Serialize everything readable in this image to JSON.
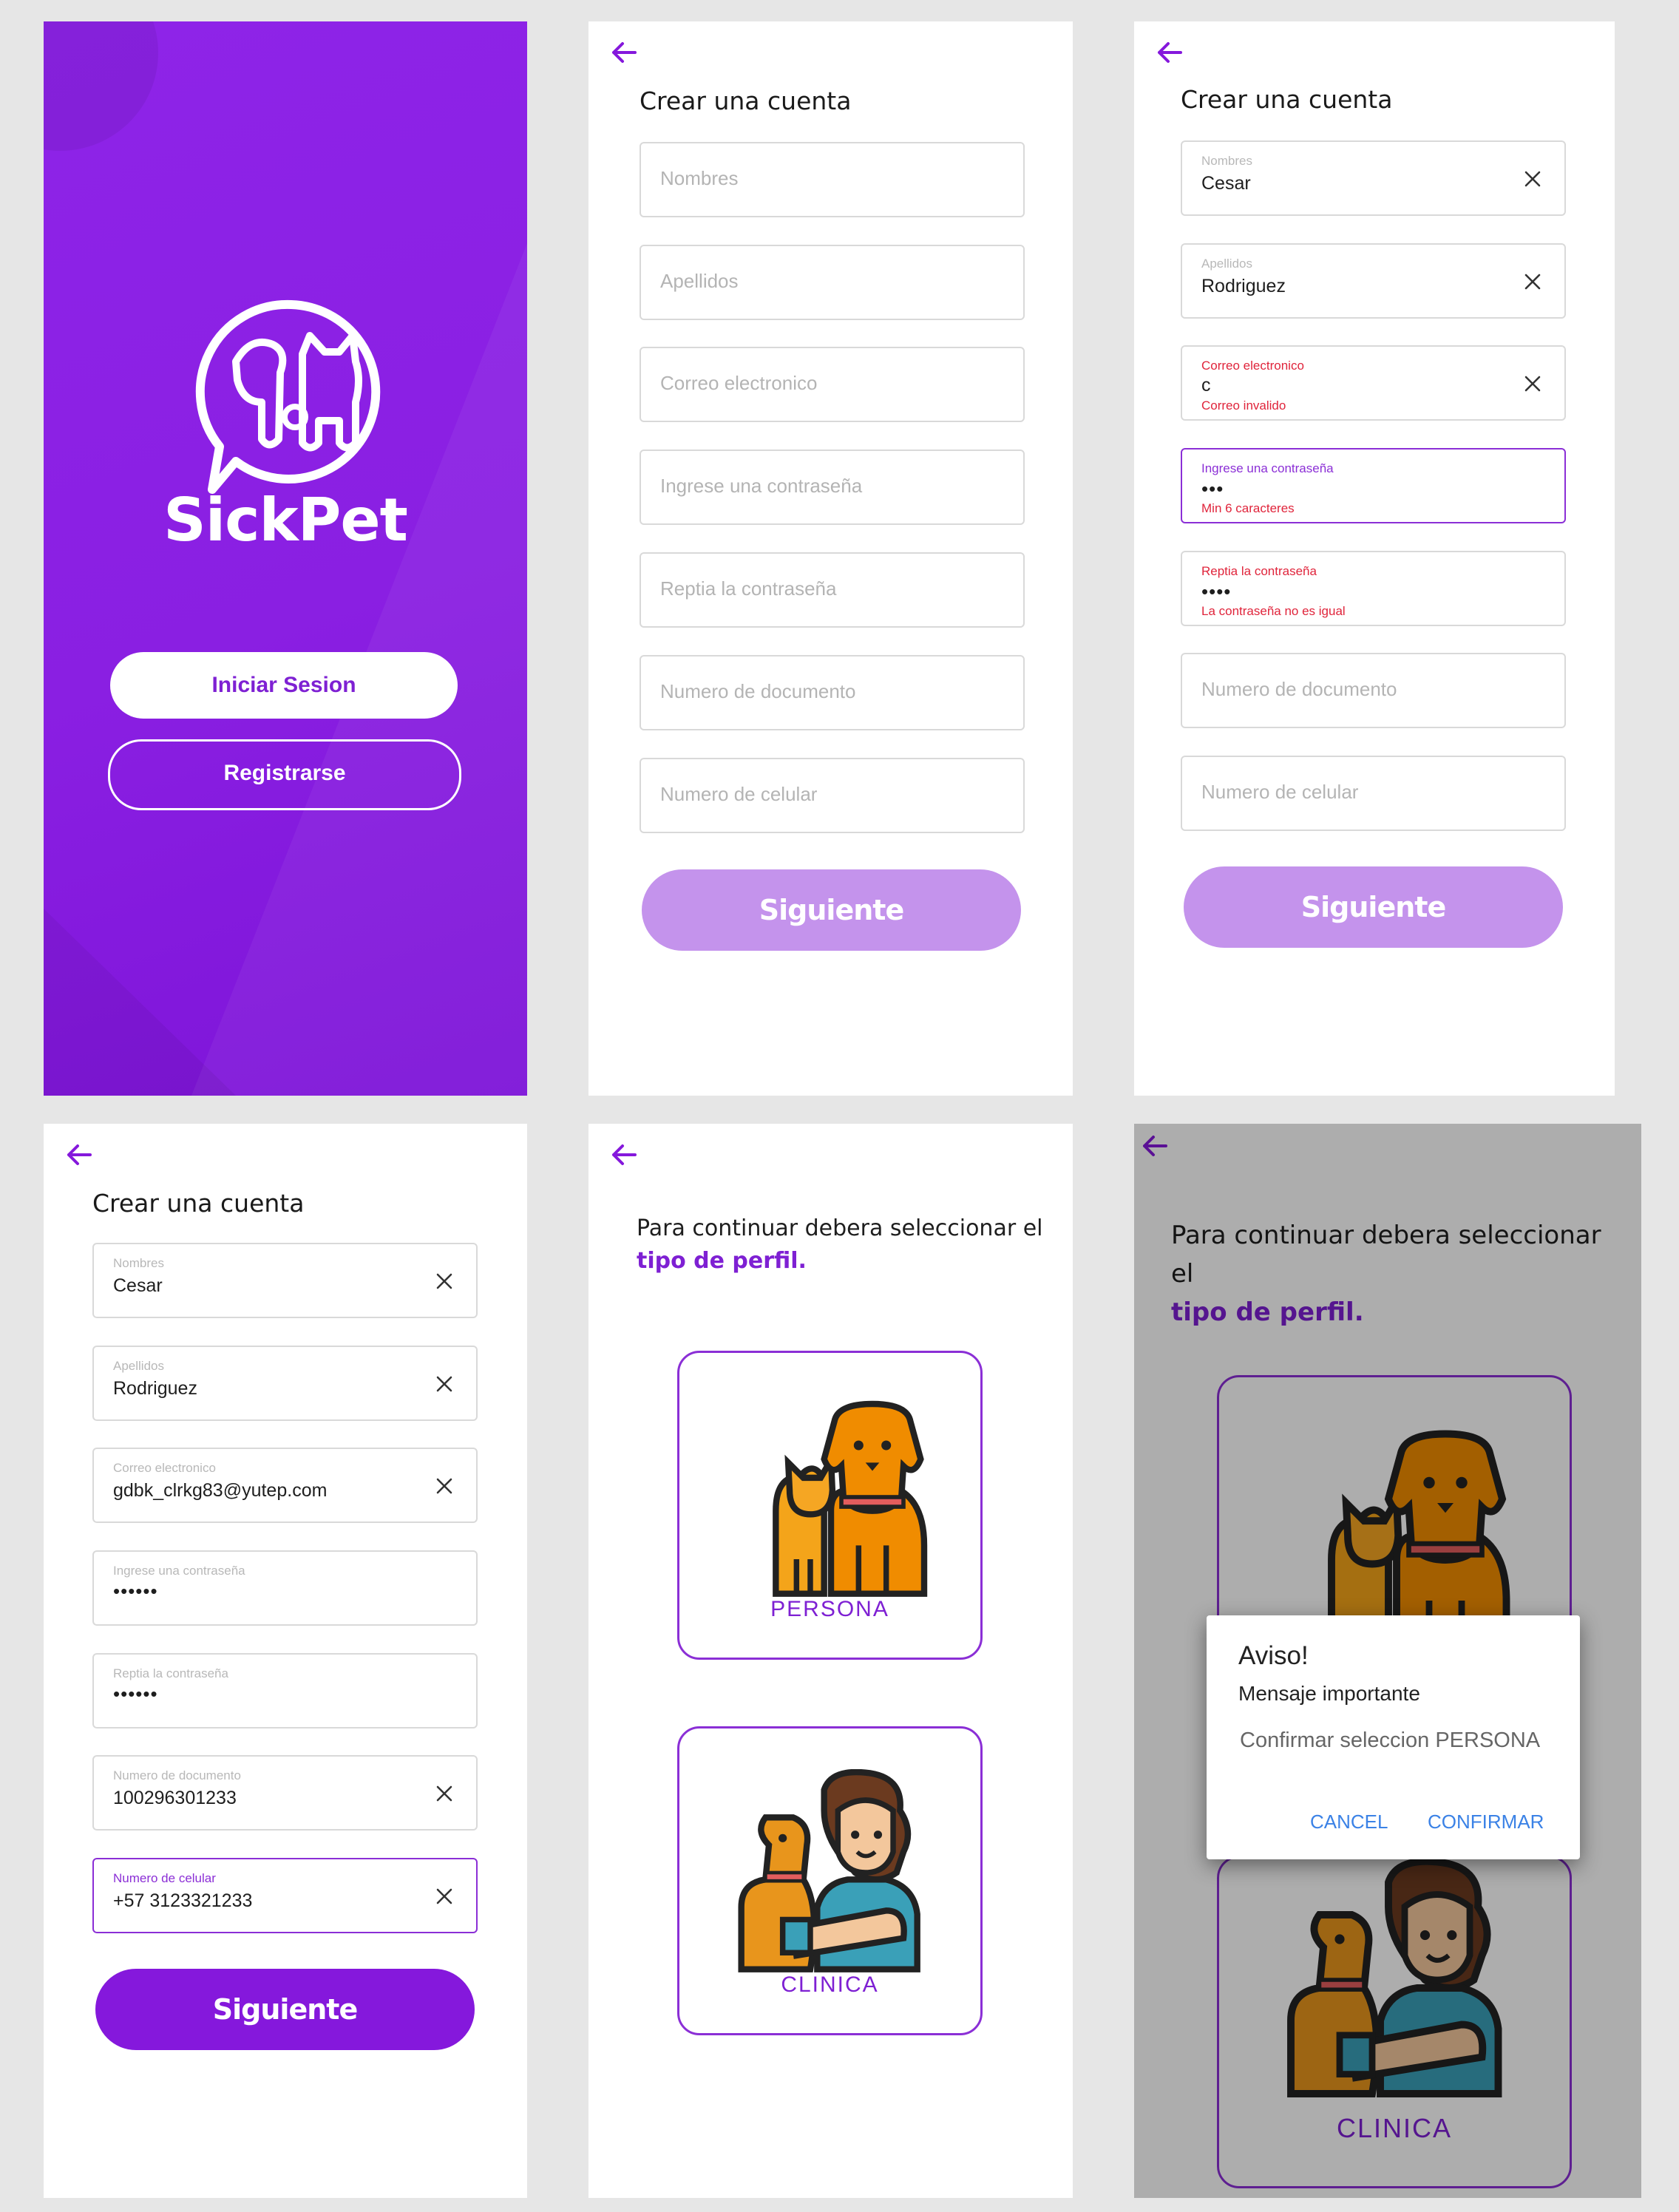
{
  "colors": {
    "accent": "#8518dc",
    "accent_light": "#c493ec",
    "error": "#e0243b",
    "link": "#3b82e6"
  },
  "welcome": {
    "app_name": "SickPet",
    "login_label": "Iniciar Sesion",
    "register_label": "Registrarse"
  },
  "form_empty": {
    "title": "Crear una cuenta",
    "fields": [
      {
        "placeholder": "Nombres"
      },
      {
        "placeholder": "Apellidos"
      },
      {
        "placeholder": "Correo electronico"
      },
      {
        "placeholder": "Ingrese una contraseña"
      },
      {
        "placeholder": "Reptia la contraseña"
      },
      {
        "placeholder": "Numero de documento"
      },
      {
        "placeholder": "Numero de celular"
      }
    ],
    "next_label": "Siguiente"
  },
  "form_errors": {
    "title": "Crear una cuenta",
    "fields": [
      {
        "label": "Nombres",
        "value": "Cesar"
      },
      {
        "label": "Apellidos",
        "value": "Rodriguez"
      },
      {
        "label": "Correo electronico",
        "value": "c",
        "error": "Correo invalido"
      },
      {
        "label": "Ingrese una contraseña",
        "value": "•••",
        "error": "Min 6 caracteres"
      },
      {
        "label": "Reptia la contraseña",
        "value": "••••",
        "error": "La contraseña no es igual"
      },
      {
        "placeholder": "Numero de documento"
      },
      {
        "placeholder": "Numero de celular"
      }
    ],
    "next_label": "Siguiente"
  },
  "form_complete": {
    "title": "Crear una cuenta",
    "fields": [
      {
        "label": "Nombres",
        "value": "Cesar"
      },
      {
        "label": "Apellidos",
        "value": "Rodriguez"
      },
      {
        "label": "Correo electronico",
        "value": "gdbk_clrkg83@yutep.com"
      },
      {
        "label": "Ingrese una contraseña",
        "value": "••••••"
      },
      {
        "label": "Reptia la contraseña",
        "value": "••••••"
      },
      {
        "label": "Numero de documento",
        "value": "100296301233"
      },
      {
        "label": "Numero de celular",
        "value": "+57 3123321233"
      }
    ],
    "next_label": "Siguiente"
  },
  "profile": {
    "intro": "Para continuar debera seleccionar el",
    "intro_bold": "tipo de perfil.",
    "option_person": "PERSONA",
    "option_clinic": "CLINICA"
  },
  "dialog": {
    "title": "Aviso!",
    "subtitle": "Mensaje importante",
    "message": "Confirmar seleccion PERSONA",
    "cancel": "CANCEL",
    "confirm": "CONFIRMAR"
  }
}
